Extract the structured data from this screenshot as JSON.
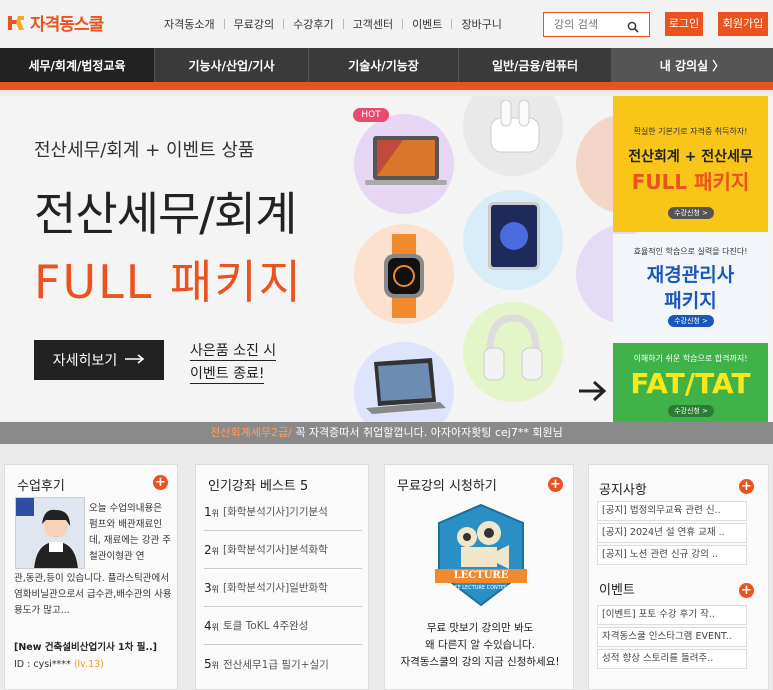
{
  "brand": {
    "name": "자격동스쿨",
    "accent": "#e8531f"
  },
  "topnav": {
    "items": [
      "자격동소개",
      "무료강의",
      "수강후기",
      "고객센터",
      "이벤트",
      "장바구니"
    ]
  },
  "search": {
    "placeholder": "강의 검색"
  },
  "auth": {
    "login": "로그인",
    "join": "회원가입"
  },
  "mainnav": {
    "categories": [
      "세무/회계/법정교육",
      "기능사/산업/기사",
      "기술사/기능장",
      "일반/금융/컴퓨터"
    ],
    "my_classroom": "내 강의실 〉"
  },
  "banner": {
    "subtitle": "전산세무/회계 + 이벤트 상품",
    "title_line1": "전산세무/회계",
    "title_line2": "FULL 패키지",
    "cta": "자세히보기",
    "gift_line1": "사은품 소진 시",
    "gift_line2": "이벤트 종료!",
    "hot_badge": "HOT",
    "products": [
      "laptop-icon",
      "earbuds-icon",
      "smartwatch-icon",
      "tablet-icon",
      "headphones-icon",
      "laptop-icon"
    ]
  },
  "promos": [
    {
      "small": "확실한 기본기로 자격증 취득하자!",
      "big1": "전산회계 + 전산세무",
      "big2": "FULL 패키지",
      "pill": "수강신청 >"
    },
    {
      "small": "효율적인 학습으로 실력을 다진다!",
      "big1": "재경관리사",
      "big2": "패키지",
      "pill": "수강신청 >"
    },
    {
      "small": "이해하기 쉬운 학습으로 합격까지!",
      "big1": "FAT/TAT",
      "pill": "수강신청 >"
    }
  ],
  "ticker": {
    "highlight": "전산회계세무2급/",
    "text": " 꼭 자격증따서 취업할껍니다. 아자아자홧팅 cej7** 회원님"
  },
  "review": {
    "title": "수업후기",
    "text_top": "오늘 수업의내용은 펌프와 배관재료인데, 재료에는 강관 주철관이형관 연",
    "text_bottom": "관,동관,등이 있습니다. 플라스틱관에서 염화비닐관으로서 급수관,배수관의 사용용도가 많고...",
    "review_title": "[New 건축설비산업기사 1차 필..]",
    "id_label": "ID : cysi****",
    "level": "(lv.13)"
  },
  "best5": {
    "title": "인기강좌 베스트 5",
    "items": [
      {
        "rank": "1",
        "unit": "위",
        "category": "[화학분석기사]",
        "name": "기기분석"
      },
      {
        "rank": "2",
        "unit": "위",
        "category": "[화학분석기사]",
        "name": "분석화학"
      },
      {
        "rank": "3",
        "unit": "위",
        "category": "[화학분석기사]",
        "name": "일반화학"
      },
      {
        "rank": "4",
        "unit": "위",
        "category": "",
        "name": "토클 ToKL 4주완성"
      },
      {
        "rank": "5",
        "unit": "위",
        "category": "",
        "name": "전산세무1급 필기+실기"
      }
    ]
  },
  "free": {
    "title": "무료강의 시청하기",
    "badge": "LECTURE",
    "badge_sub": "FREE LECTURE CONTENTS",
    "desc1": "무료 맛보기 강의만 봐도",
    "desc2": "왜 다른지 알 수있습니다.",
    "desc3": "자격동스쿨의 강의 지금 신청하세요!"
  },
  "notice": {
    "title": "공지사항",
    "items": [
      "[공지] 법정의무교육 관련 신..",
      "[공지] 2024년 설 연휴 교재 ..",
      "[공지] 노션 관련 신규 강의 .."
    ]
  },
  "event": {
    "title": "이벤트",
    "items": [
      "[이벤트] 포토 수강 후기 작..",
      "자격동스쿨 인스타그램 EVENT..",
      "성적 향상 스토리를 들려주.."
    ]
  }
}
